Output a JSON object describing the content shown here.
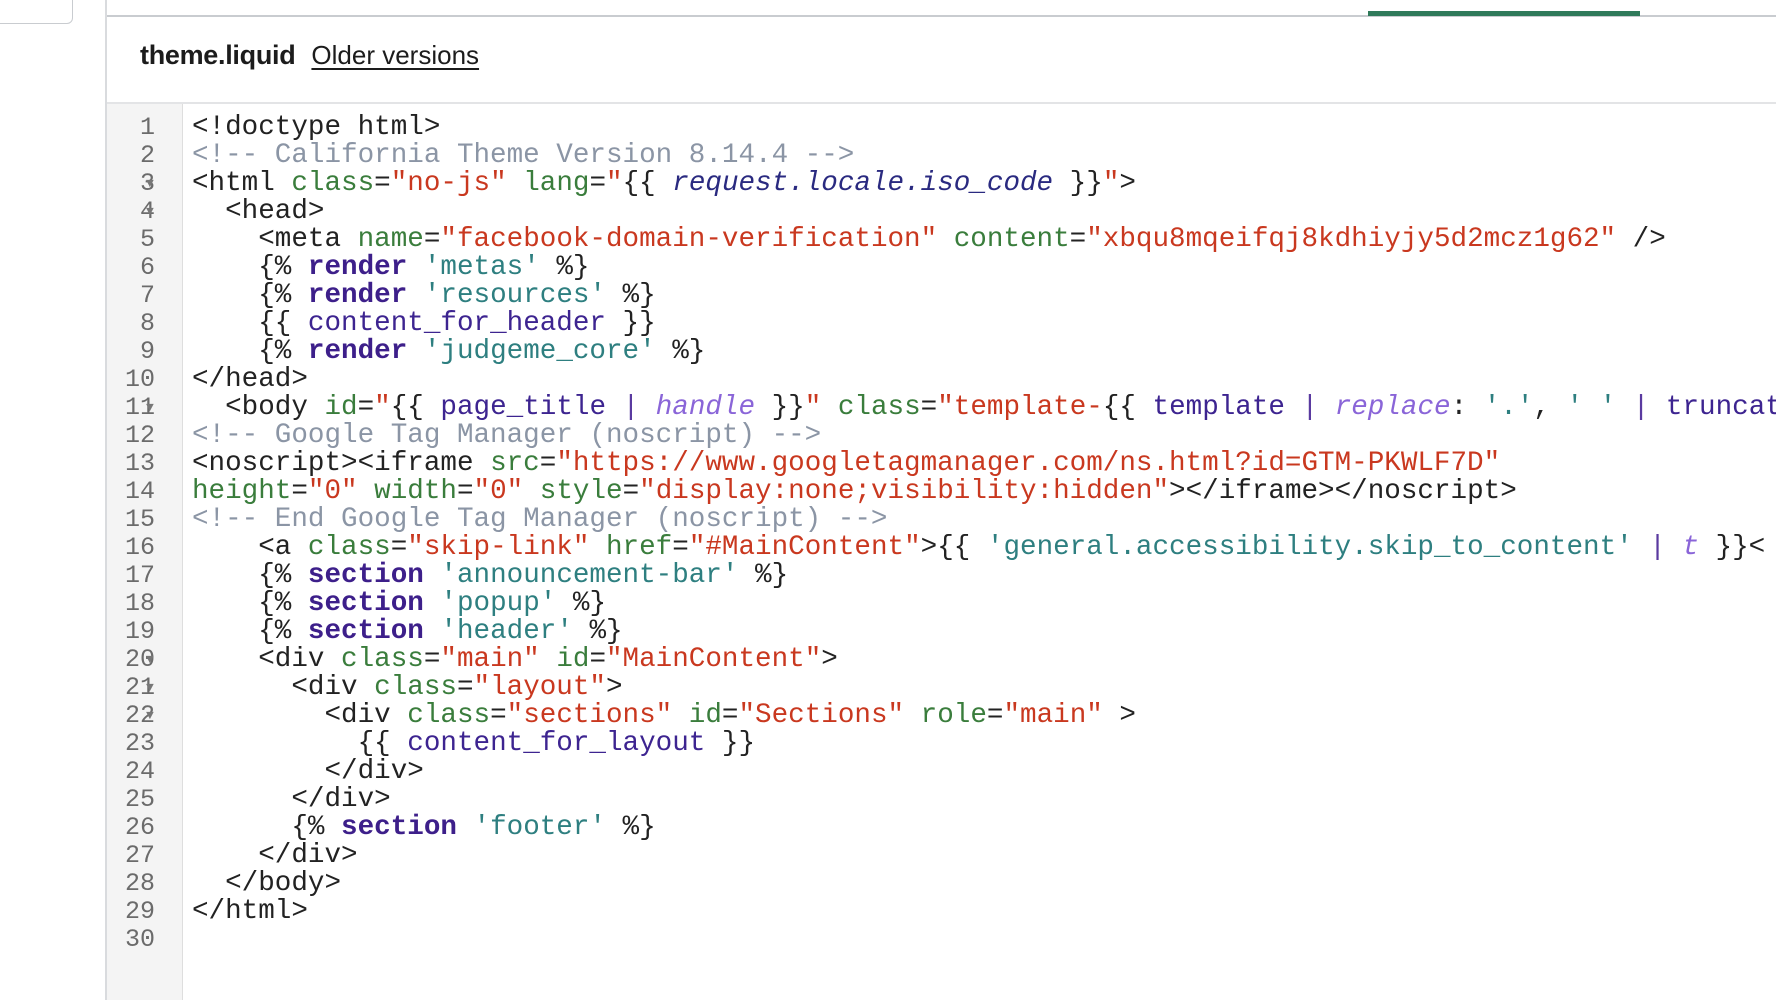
{
  "header": {
    "file_name": "theme.liquid",
    "older_versions_link": "Older versions"
  },
  "colors": {
    "tab_indicator": "#2f7a5a",
    "attribute": "#3a7d3c",
    "string": "#c9381f",
    "comment": "#8b95a5",
    "liquid_keyword": "#3d1f8a",
    "liquid_string": "#2e7f80",
    "filter": "#8a65d8"
  },
  "editor": {
    "lines": [
      {
        "n": "1",
        "fold": false,
        "tokens": [
          [
            "t",
            "<!doctype html>"
          ]
        ]
      },
      {
        "n": "2",
        "fold": false,
        "tokens": [
          [
            "c",
            "<!-- California Theme Version 8.14.4 -->"
          ]
        ]
      },
      {
        "n": "3",
        "fold": true,
        "tokens": [
          [
            "t",
            "<html "
          ],
          [
            "a",
            "class"
          ],
          [
            "t",
            "="
          ],
          [
            "s",
            "\"no-js\""
          ],
          [
            "t",
            " "
          ],
          [
            "a",
            "lang"
          ],
          [
            "t",
            "="
          ],
          [
            "s",
            "\""
          ],
          [
            "t",
            "{{ "
          ],
          [
            "vi",
            "request.locale.iso_code"
          ],
          [
            "t",
            " }}"
          ],
          [
            "s",
            "\""
          ],
          [
            "t",
            ">"
          ]
        ]
      },
      {
        "n": "4",
        "fold": true,
        "tokens": [
          [
            "t",
            "  <head>"
          ]
        ]
      },
      {
        "n": "5",
        "fold": false,
        "tokens": [
          [
            "t",
            "    <meta "
          ],
          [
            "a",
            "name"
          ],
          [
            "t",
            "="
          ],
          [
            "s",
            "\"facebook-domain-verification\""
          ],
          [
            "t",
            " "
          ],
          [
            "a",
            "content"
          ],
          [
            "t",
            "="
          ],
          [
            "s",
            "\"xbqu8mqeifqj8kdhiyjy5d2mcz1g62\""
          ],
          [
            "t",
            " />"
          ]
        ]
      },
      {
        "n": "6",
        "fold": false,
        "tokens": [
          [
            "t",
            "    {% "
          ],
          [
            "k",
            "render"
          ],
          [
            "t",
            " "
          ],
          [
            "q",
            "'metas'"
          ],
          [
            "t",
            " %}"
          ]
        ]
      },
      {
        "n": "7",
        "fold": false,
        "tokens": [
          [
            "t",
            "    {% "
          ],
          [
            "k",
            "render"
          ],
          [
            "t",
            " "
          ],
          [
            "q",
            "'resources'"
          ],
          [
            "t",
            " %}"
          ]
        ]
      },
      {
        "n": "8",
        "fold": false,
        "tokens": [
          [
            "t",
            "    {{ "
          ],
          [
            "v",
            "content_for_header"
          ],
          [
            "t",
            " }}"
          ]
        ]
      },
      {
        "n": "9",
        "fold": false,
        "tokens": [
          [
            "t",
            "    {% "
          ],
          [
            "k",
            "render"
          ],
          [
            "t",
            " "
          ],
          [
            "q",
            "'judgeme_core'"
          ],
          [
            "t",
            " %}"
          ]
        ]
      },
      {
        "n": "10",
        "fold": false,
        "tokens": [
          [
            "t",
            "</head>"
          ]
        ]
      },
      {
        "n": "11",
        "fold": true,
        "tokens": [
          [
            "t",
            "  <body "
          ],
          [
            "a",
            "id"
          ],
          [
            "t",
            "="
          ],
          [
            "s",
            "\""
          ],
          [
            "t",
            "{{ "
          ],
          [
            "v",
            "page_title"
          ],
          [
            "t",
            " "
          ],
          [
            "p",
            "|"
          ],
          [
            "t",
            " "
          ],
          [
            "f",
            "handle"
          ],
          [
            "t",
            " }}"
          ],
          [
            "s",
            "\""
          ],
          [
            "t",
            " "
          ],
          [
            "a",
            "class"
          ],
          [
            "t",
            "="
          ],
          [
            "s",
            "\"template-"
          ],
          [
            "t",
            "{{ "
          ],
          [
            "v",
            "template"
          ],
          [
            "t",
            " "
          ],
          [
            "p",
            "|"
          ],
          [
            "t",
            " "
          ],
          [
            "f",
            "replace"
          ],
          [
            "t",
            ": "
          ],
          [
            "q",
            "'.'"
          ],
          [
            "t",
            ", "
          ],
          [
            "q",
            "' '"
          ],
          [
            "t",
            " "
          ],
          [
            "p",
            "|"
          ],
          [
            "t",
            " "
          ],
          [
            "v",
            "truncate"
          ]
        ]
      },
      {
        "n": "12",
        "fold": false,
        "tokens": [
          [
            "c",
            "<!-- Google Tag Manager (noscript) -->"
          ]
        ]
      },
      {
        "n": "13",
        "fold": false,
        "tokens": [
          [
            "t",
            "<noscript><iframe "
          ],
          [
            "a",
            "src"
          ],
          [
            "t",
            "="
          ],
          [
            "s",
            "\"https://www.googletagmanager.com/ns.html?id=GTM-PKWLF7D\""
          ]
        ]
      },
      {
        "n": "14",
        "fold": false,
        "tokens": [
          [
            "a",
            "height"
          ],
          [
            "t",
            "="
          ],
          [
            "s",
            "\"0\""
          ],
          [
            "t",
            " "
          ],
          [
            "a",
            "width"
          ],
          [
            "t",
            "="
          ],
          [
            "s",
            "\"0\""
          ],
          [
            "t",
            " "
          ],
          [
            "a",
            "style"
          ],
          [
            "t",
            "="
          ],
          [
            "s",
            "\"display:none;visibility:hidden\""
          ],
          [
            "t",
            "></iframe></noscript>"
          ]
        ]
      },
      {
        "n": "15",
        "fold": false,
        "tokens": [
          [
            "c",
            "<!-- End Google Tag Manager (noscript) -->"
          ]
        ]
      },
      {
        "n": "16",
        "fold": false,
        "tokens": [
          [
            "t",
            "    <a "
          ],
          [
            "a",
            "class"
          ],
          [
            "t",
            "="
          ],
          [
            "s",
            "\"skip-link\""
          ],
          [
            "t",
            " "
          ],
          [
            "a",
            "href"
          ],
          [
            "t",
            "="
          ],
          [
            "s",
            "\"#MainContent\""
          ],
          [
            "t",
            ">{{ "
          ],
          [
            "q",
            "'general.accessibility.skip_to_content'"
          ],
          [
            "t",
            " "
          ],
          [
            "p",
            "|"
          ],
          [
            "t",
            " "
          ],
          [
            "f",
            "t"
          ],
          [
            "t",
            " }}<"
          ]
        ]
      },
      {
        "n": "17",
        "fold": false,
        "tokens": [
          [
            "t",
            "    {% "
          ],
          [
            "k",
            "section"
          ],
          [
            "t",
            " "
          ],
          [
            "q",
            "'announcement-bar'"
          ],
          [
            "t",
            " %}"
          ]
        ]
      },
      {
        "n": "18",
        "fold": false,
        "tokens": [
          [
            "t",
            "    {% "
          ],
          [
            "k",
            "section"
          ],
          [
            "t",
            " "
          ],
          [
            "q",
            "'popup'"
          ],
          [
            "t",
            " %}"
          ]
        ]
      },
      {
        "n": "19",
        "fold": false,
        "tokens": [
          [
            "t",
            "    {% "
          ],
          [
            "k",
            "section"
          ],
          [
            "t",
            " "
          ],
          [
            "q",
            "'header'"
          ],
          [
            "t",
            " %}"
          ]
        ]
      },
      {
        "n": "20",
        "fold": true,
        "tokens": [
          [
            "t",
            "    <div "
          ],
          [
            "a",
            "class"
          ],
          [
            "t",
            "="
          ],
          [
            "s",
            "\"main\""
          ],
          [
            "t",
            " "
          ],
          [
            "a",
            "id"
          ],
          [
            "t",
            "="
          ],
          [
            "s",
            "\"MainContent\""
          ],
          [
            "t",
            ">"
          ]
        ]
      },
      {
        "n": "21",
        "fold": true,
        "tokens": [
          [
            "t",
            "      <div "
          ],
          [
            "a",
            "class"
          ],
          [
            "t",
            "="
          ],
          [
            "s",
            "\"layout\""
          ],
          [
            "t",
            ">"
          ]
        ]
      },
      {
        "n": "22",
        "fold": true,
        "tokens": [
          [
            "t",
            "        <div "
          ],
          [
            "a",
            "class"
          ],
          [
            "t",
            "="
          ],
          [
            "s",
            "\"sections\""
          ],
          [
            "t",
            " "
          ],
          [
            "a",
            "id"
          ],
          [
            "t",
            "="
          ],
          [
            "s",
            "\"Sections\""
          ],
          [
            "t",
            " "
          ],
          [
            "a",
            "role"
          ],
          [
            "t",
            "="
          ],
          [
            "s",
            "\"main\""
          ],
          [
            "t",
            " >"
          ]
        ]
      },
      {
        "n": "23",
        "fold": false,
        "tokens": [
          [
            "t",
            "          {{ "
          ],
          [
            "v",
            "content_for_layout"
          ],
          [
            "t",
            " }}"
          ]
        ]
      },
      {
        "n": "24",
        "fold": false,
        "tokens": [
          [
            "t",
            "        </div>"
          ]
        ]
      },
      {
        "n": "25",
        "fold": false,
        "tokens": [
          [
            "t",
            "      </div>"
          ]
        ]
      },
      {
        "n": "26",
        "fold": false,
        "tokens": [
          [
            "t",
            "      {% "
          ],
          [
            "k",
            "section"
          ],
          [
            "t",
            " "
          ],
          [
            "q",
            "'footer'"
          ],
          [
            "t",
            " %}"
          ]
        ]
      },
      {
        "n": "27",
        "fold": false,
        "tokens": [
          [
            "t",
            "    </div>"
          ]
        ]
      },
      {
        "n": "28",
        "fold": false,
        "tokens": [
          [
            "t",
            "  </body>"
          ]
        ]
      },
      {
        "n": "29",
        "fold": false,
        "tokens": [
          [
            "t",
            "</html>"
          ]
        ]
      },
      {
        "n": "30",
        "fold": false,
        "tokens": []
      }
    ]
  }
}
